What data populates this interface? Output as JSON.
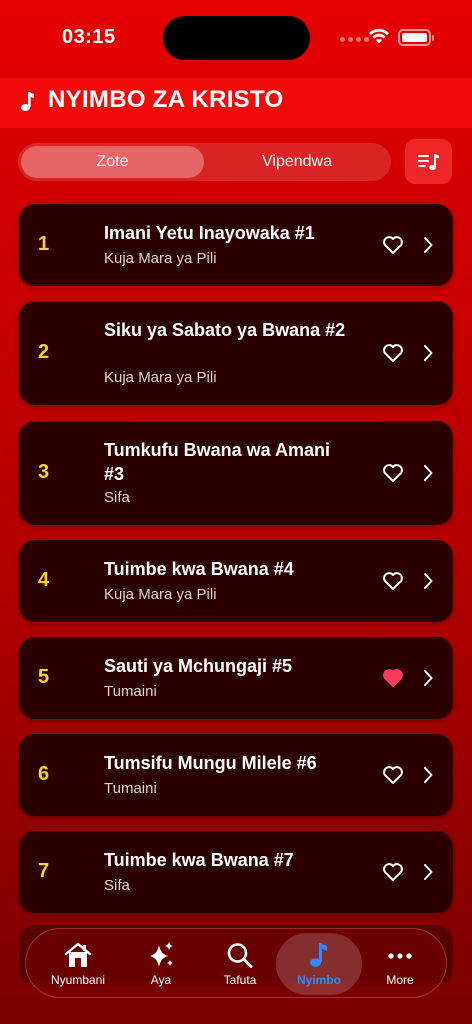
{
  "status": {
    "time": "03:15"
  },
  "header": {
    "title": "NYIMBO ZA KRISTO",
    "icon": "music-note-icon"
  },
  "filter": {
    "segments": [
      "Zote",
      "Vipendwa"
    ],
    "selected": "Zote"
  },
  "songs": [
    {
      "number": "1",
      "title": "Imani Yetu Inayowaka #1",
      "category": "Kuja Mara ya Pili",
      "favorite": false
    },
    {
      "number": "2",
      "title": "Siku ya Sabato ya Bwana #2",
      "category": "Kuja Mara ya Pili",
      "favorite": false
    },
    {
      "number": "3",
      "title": "Tumkufu Bwana wa Amani #3",
      "category": "Sifa",
      "favorite": false
    },
    {
      "number": "4",
      "title": "Tuimbe kwa Bwana #4",
      "category": "Kuja Mara ya Pili",
      "favorite": false
    },
    {
      "number": "5",
      "title": "Sauti ya Mchungaji #5",
      "category": "Tumaini",
      "favorite": true
    },
    {
      "number": "6",
      "title": "Tumsifu Mungu Milele #6",
      "category": "Tumaini",
      "favorite": false
    },
    {
      "number": "7",
      "title": "Tuimbe kwa Bwana #7",
      "category": "Sifa",
      "favorite": false
    }
  ],
  "tabs": [
    {
      "label": "Nyumbani",
      "icon": "home-icon"
    },
    {
      "label": "Aya",
      "icon": "sparkles-icon"
    },
    {
      "label": "Tafuta",
      "icon": "search-icon"
    },
    {
      "label": "Nyimbo",
      "icon": "music-note-icon",
      "active": true
    },
    {
      "label": "More",
      "icon": "more-icon"
    }
  ],
  "colors": {
    "accent": "#ffd21e",
    "favorite": "#ff3b5c",
    "active_tab": "#2d8cff"
  }
}
